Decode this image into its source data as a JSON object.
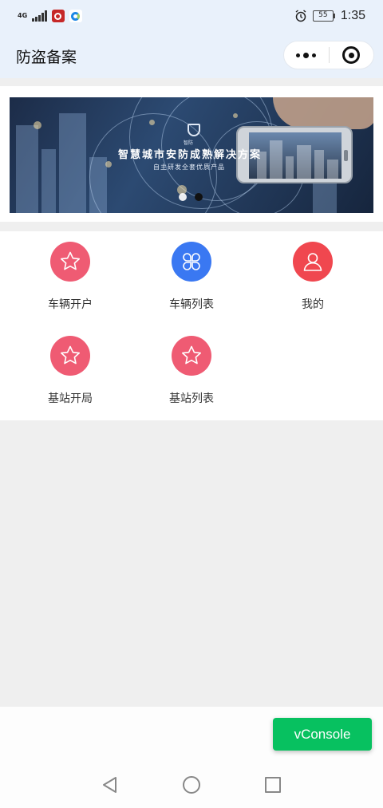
{
  "status_bar": {
    "network": "4G",
    "time": "1:35",
    "battery": "55"
  },
  "nav": {
    "title": "防盗备案"
  },
  "banner": {
    "title": "智慧城市安防成熟解决方案",
    "subtitle": "自主研发全套优质产品",
    "logo_text": "智防",
    "slides": 2,
    "active_slide": 2
  },
  "grid": {
    "items": [
      {
        "label": "车辆开户",
        "icon": "star-icon",
        "color": "#ef5b73"
      },
      {
        "label": "车辆列表",
        "icon": "clover-icon",
        "color": "#3a78f2"
      },
      {
        "label": "我的",
        "icon": "user-icon",
        "color": "#f0474f"
      },
      {
        "label": "基站开局",
        "icon": "star-icon",
        "color": "#ef5b73"
      },
      {
        "label": "基站列表",
        "icon": "star-icon",
        "color": "#ef5b73"
      }
    ]
  },
  "vconsole": {
    "label": "vConsole"
  },
  "colors": {
    "nav_bg": "#e9f1fb",
    "page_bg": "#efefef",
    "vconsole": "#07c160"
  }
}
